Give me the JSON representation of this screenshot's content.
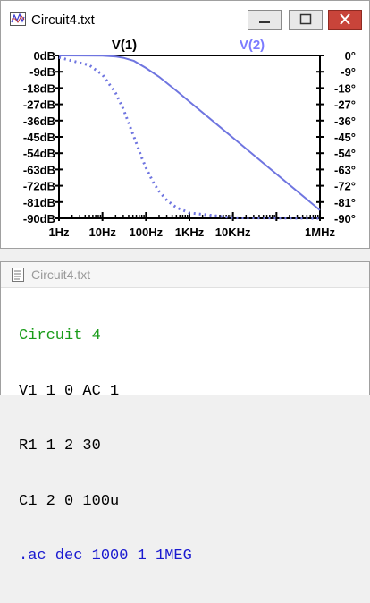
{
  "plot_window": {
    "title": "Circuit4.txt",
    "colors": {
      "v1": "#000000",
      "v2": "#7b7bff",
      "trace": "#6f75e0",
      "grid": "#000000"
    }
  },
  "netlist_window": {
    "title": "Circuit4.txt",
    "lines": [
      {
        "text": "Circuit 4",
        "color": "#1a9c1a"
      },
      {
        "text": "V1 1 0 AC 1",
        "color": "#000000"
      },
      {
        "text": "R1 1 2 30",
        "color": "#000000"
      },
      {
        "text": "C1 2 0 100u",
        "color": "#000000"
      },
      {
        "text": ".ac dec 1000 1 1MEG",
        "color": "#1a1ad0"
      }
    ]
  },
  "chart_data": {
    "type": "line",
    "x_scale": "log",
    "xlim": [
      1,
      1000000
    ],
    "x_tick_labels": [
      "1Hz",
      "10Hz",
      "100Hz",
      "1KHz",
      "10KHz",
      "1MHz"
    ],
    "x_tick_values": [
      1,
      10,
      100,
      1000,
      10000,
      1000000
    ],
    "y_left_tick_labels": [
      "0dB",
      "-9dB",
      "-18dB",
      "-27dB",
      "-36dB",
      "-45dB",
      "-54dB",
      "-63dB",
      "-72dB",
      "-81dB",
      "-90dB"
    ],
    "y_right_tick_labels": [
      "0°",
      "-9°",
      "-18°",
      "-27°",
      "-36°",
      "-45°",
      "-54°",
      "-63°",
      "-72°",
      "-81°",
      "-90°"
    ],
    "ylim": [
      -90,
      0
    ],
    "grid": false,
    "legend": "top",
    "series": [
      {
        "name": "V(1)",
        "axis": "left",
        "style": "none",
        "x": [],
        "y": []
      },
      {
        "name": "V(2)",
        "axis": "left",
        "unit": "dB",
        "style": "solid",
        "x": [
          1,
          10,
          20,
          30,
          53,
          100,
          200,
          500,
          1000,
          10000,
          100000,
          1000000
        ],
        "y": [
          0,
          -0.1,
          -0.6,
          -1.3,
          -3,
          -6.9,
          -11.8,
          -19.5,
          -25.5,
          -45.5,
          -65.5,
          -85.5
        ]
      },
      {
        "name": "V(2) phase",
        "axis": "right",
        "unit": "deg",
        "style": "dotted",
        "x": [
          1,
          5,
          10,
          20,
          30,
          53,
          80,
          100,
          150,
          200,
          300,
          500,
          1000,
          10000,
          1000000
        ],
        "y": [
          -1.1,
          -5.4,
          -10.7,
          -20.7,
          -29.5,
          -45,
          -56.5,
          -62,
          -70.5,
          -75,
          -80,
          -84,
          -87,
          -89.7,
          -90
        ]
      }
    ]
  }
}
